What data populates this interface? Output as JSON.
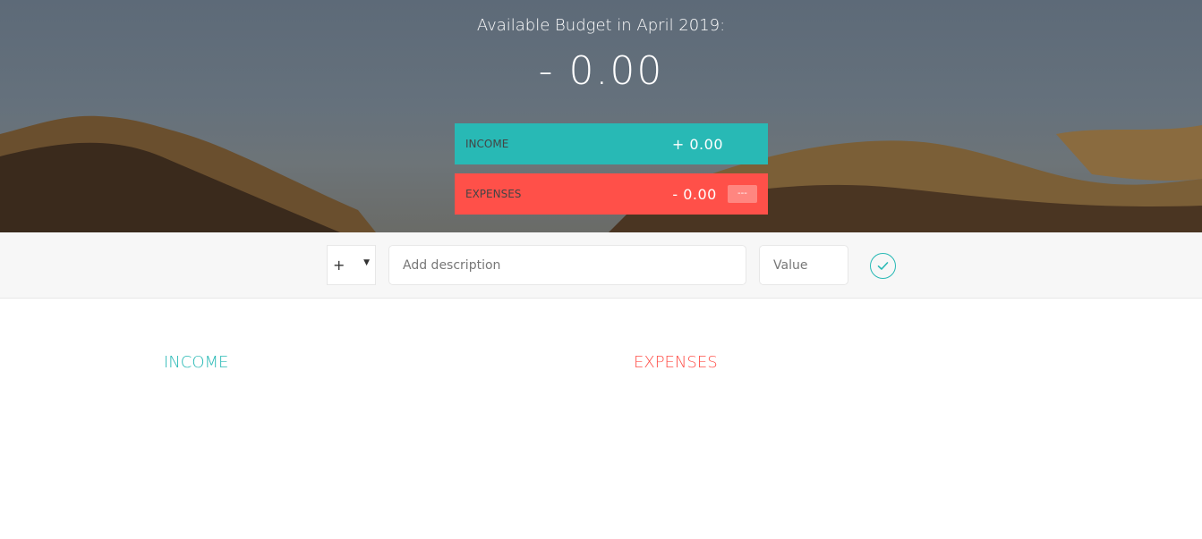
{
  "header": {
    "budget_title": "Available Budget in April 2019:",
    "budget_value": "- 0.00"
  },
  "summary": {
    "income": {
      "label": "Income",
      "value": "+ 0.00"
    },
    "expenses": {
      "label": "Expenses",
      "value": "- 0.00",
      "percentage": "---"
    }
  },
  "add": {
    "type_value": "+",
    "type_arrow": "▼",
    "description_placeholder": "Add description",
    "value_placeholder": "Value",
    "submit_icon": "checkmark-circle-icon"
  },
  "lists": {
    "income_title": "Income",
    "expenses_title": "Expenses"
  },
  "colors": {
    "income": "#28b9b5",
    "expenses": "#ff5049",
    "expenses_badge": "#ff8680"
  }
}
